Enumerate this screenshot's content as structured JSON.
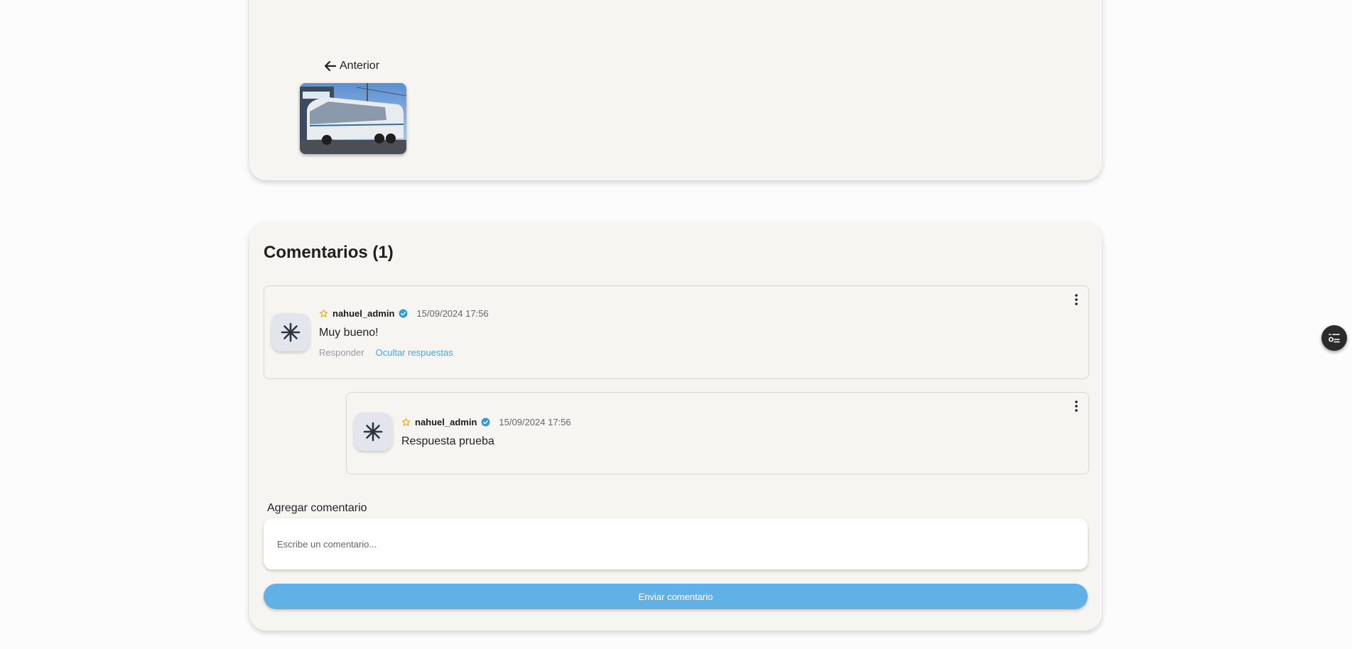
{
  "gallery": {
    "prev_label": "Anterior",
    "thumbnail_alt": "bus"
  },
  "comments_section": {
    "title": "Comentarios (1)",
    "comments": [
      {
        "username": "nahuel_admin",
        "date": "15/09/2024 17:56",
        "text": "Muy bueno!",
        "reply_label": "Responder",
        "hide_replies_label": "Ocultar respuestas"
      },
      {
        "username": "nahuel_admin",
        "date": "15/09/2024 17:56",
        "text": "Respuesta prueba"
      }
    ],
    "add_label": "Agregar comentario",
    "input_placeholder": "Escribe un comentario...",
    "submit_label": "Enviar comentario"
  },
  "icons": {
    "prev": "arrow-left-icon",
    "avatar": "asterisk-icon",
    "star": "star-outline-icon",
    "verified": "verified-badge-icon",
    "menu": "more-vertical-icon",
    "fab": "toggle-list-icon"
  },
  "colors": {
    "card_bg": "#f6f5f2",
    "accent": "#62b1e6",
    "star": "#f5a623",
    "verified": "#2d9cdb",
    "link": "#4aa3df"
  }
}
